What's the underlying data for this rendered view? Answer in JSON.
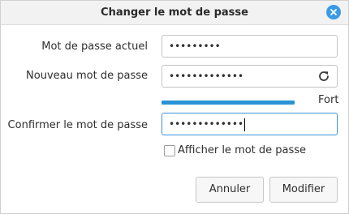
{
  "window": {
    "title": "Changer le mot de passe",
    "close_icon": "close-icon",
    "accent_color": "#3a9ae6"
  },
  "form": {
    "current": {
      "label": "Mot de passe actuel",
      "value": "•••••••••"
    },
    "new": {
      "label": "Nouveau mot de passe",
      "value": "•••••••••••••",
      "refresh_icon": "refresh-icon"
    },
    "strength": {
      "label": "Fort",
      "level": 1.0,
      "color": "#2a93d5"
    },
    "confirm": {
      "label": "Confirmer le mot de passe",
      "value": "•••••••••••••"
    },
    "show_password": {
      "label": "Afficher le mot de passe",
      "checked": false
    }
  },
  "buttons": {
    "cancel_label": "Annuler",
    "modify_label": "Modifier"
  }
}
